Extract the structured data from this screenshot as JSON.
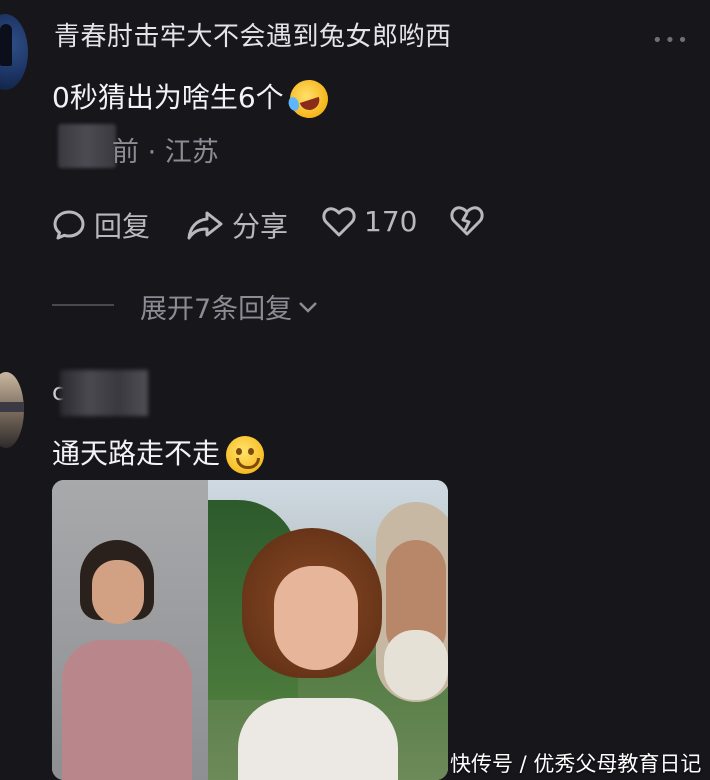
{
  "comment1": {
    "username": "青春肘击牢大不会遇到兔女郎哟西",
    "text": "0秒猜出为啥生6个",
    "time_location": "前 · 江苏",
    "actions": {
      "reply": "回复",
      "share": "分享",
      "likes": "170"
    },
    "more_icon": "more-dots-icon",
    "emoji": "rolling-laughing-emoji"
  },
  "expand_replies": "展开7条回复",
  "comment2": {
    "username_prefix": "c",
    "text": "通天路走不走",
    "emoji": "smiling-emoji",
    "image": "two-smiling-children-photo"
  },
  "watermark": "快传号 / 优秀父母教育日记",
  "colors": {
    "background": "#17161b",
    "primary_text": "#f3f2f7",
    "secondary_text": "#8d8b93"
  }
}
